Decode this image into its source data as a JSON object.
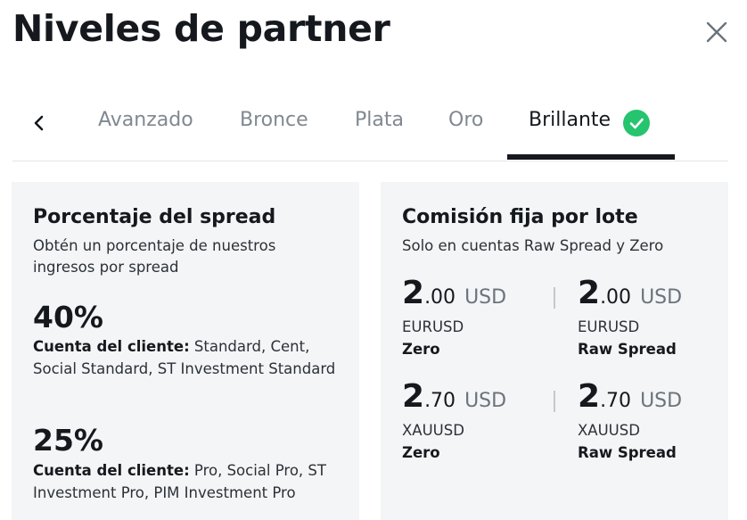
{
  "header": {
    "title": "Niveles de partner",
    "close_icon": "close-icon"
  },
  "tabs": {
    "prev_icon": "chevron-left-icon",
    "items": [
      {
        "label": "Avanzado"
      },
      {
        "label": "Bronce"
      },
      {
        "label": "Plata"
      },
      {
        "label": "Oro"
      },
      {
        "label": "Brillante",
        "active": true,
        "icon": "check-circle-icon"
      }
    ],
    "accent_color": "#15191e",
    "check_color": "#26c46e"
  },
  "spread": {
    "title": "Porcentaje del spread",
    "subtitle": "Obtén un porcentaje de nuestros ingresos por spread",
    "tiers": [
      {
        "percent": "40%",
        "account_label": "Cuenta del cliente:",
        "accounts": "Standard, Cent, Social Standard, ST Investment Standard"
      },
      {
        "percent": "25%",
        "account_label": "Cuenta del cliente:",
        "accounts": "Pro, Social Pro, ST Investment Pro, PIM Investment Pro"
      }
    ]
  },
  "commission": {
    "title": "Comisión fija por lote",
    "subtitle": "Solo en cuentas Raw Spread y Zero",
    "fees": [
      {
        "int": "2",
        "dec": ".00",
        "currency": "USD",
        "symbol": "EURUSD",
        "account": "Zero"
      },
      {
        "int": "2",
        "dec": ".00",
        "currency": "USD",
        "symbol": "EURUSD",
        "account": "Raw Spread"
      },
      {
        "int": "2",
        "dec": ".70",
        "currency": "USD",
        "symbol": "XAUUSD",
        "account": "Zero"
      },
      {
        "int": "2",
        "dec": ".70",
        "currency": "USD",
        "symbol": "XAUUSD",
        "account": "Raw Spread"
      }
    ]
  }
}
